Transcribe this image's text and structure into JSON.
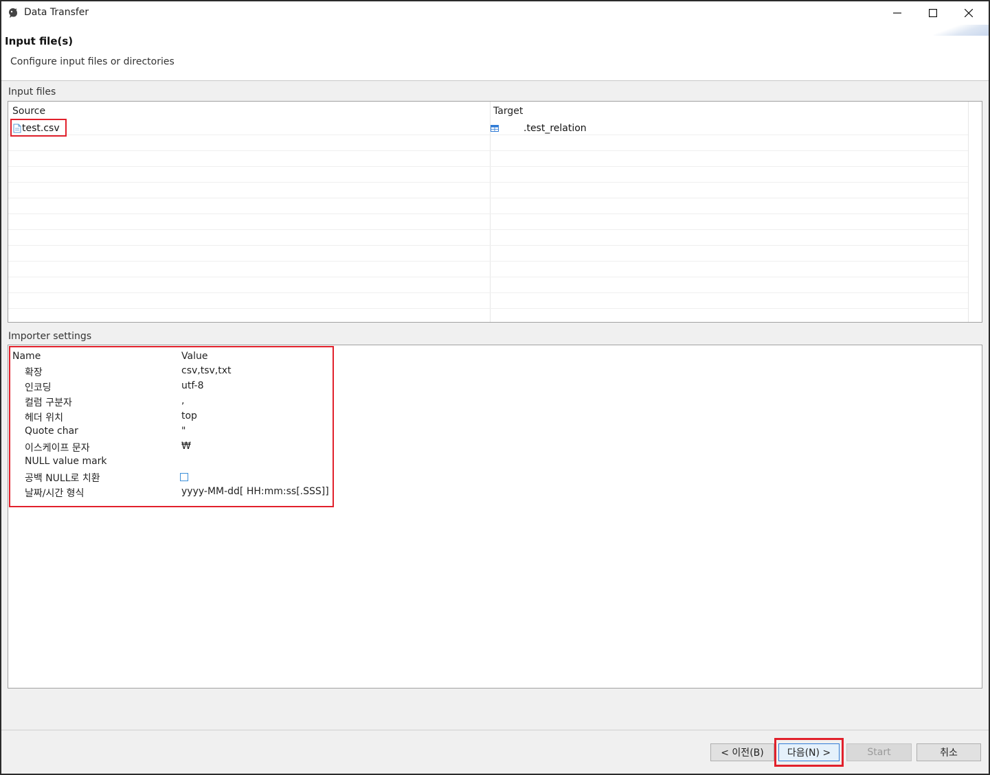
{
  "window": {
    "title": "Data Transfer"
  },
  "header": {
    "title": "Input file(s)",
    "description": "Configure input files or directories"
  },
  "input_files": {
    "group_label": "Input files",
    "columns": [
      "Source",
      "Target"
    ],
    "rows": [
      {
        "source": "test.csv",
        "target": ".test_relation"
      }
    ]
  },
  "importer_settings": {
    "group_label": "Importer settings",
    "columns": [
      "Name",
      "Value"
    ],
    "rows": [
      {
        "name": "확장",
        "value": "csv,tsv,txt"
      },
      {
        "name": "인코딩",
        "value": "utf-8"
      },
      {
        "name": "컬럼 구분자",
        "value": ","
      },
      {
        "name": "헤더 위치",
        "value": "top"
      },
      {
        "name": "Quote char",
        "value": "\""
      },
      {
        "name": "이스케이프 문자",
        "value": "₩"
      },
      {
        "name": "NULL value mark",
        "value": ""
      },
      {
        "name": "공백 NULL로 치환",
        "value": "",
        "checked": false
      },
      {
        "name": "날짜/시간 형식",
        "value": "yyyy-MM-dd[ HH:mm:ss[.SSS]]"
      }
    ]
  },
  "buttons": {
    "back": "< 이전(B)",
    "next": "다음(N) >",
    "start": "Start",
    "cancel": "취소"
  },
  "colors": {
    "highlight": "#e1202b",
    "accent": "#2f7bd6"
  }
}
